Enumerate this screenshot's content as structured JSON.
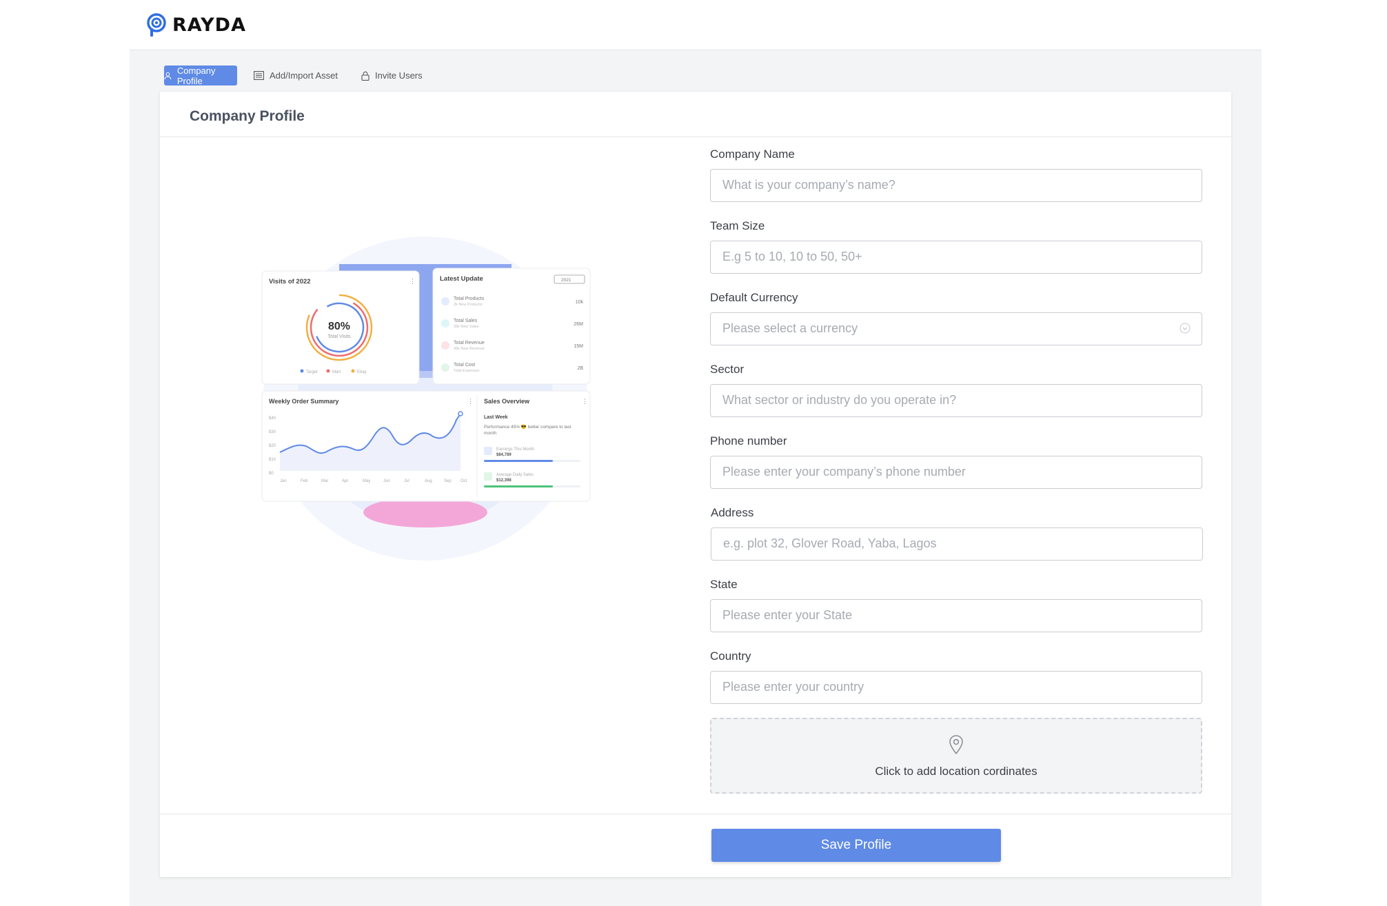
{
  "brand": {
    "name": "RAYDA"
  },
  "tabs": [
    {
      "label": "Company Profile",
      "icon": "user-icon",
      "active": true
    },
    {
      "label": "Add/Import Asset",
      "icon": "list-icon",
      "active": false
    },
    {
      "label": "Invite Users",
      "icon": "lock-icon",
      "active": false
    }
  ],
  "page": {
    "title": "Company Profile"
  },
  "form": {
    "company_name": {
      "label": "Company Name",
      "placeholder": "What is your company’s name?"
    },
    "team_size": {
      "label": "Team Size",
      "placeholder": "E.g 5 to 10, 10 to 50, 50+"
    },
    "currency": {
      "label": "Default Currency",
      "placeholder": "Please select a currency"
    },
    "sector": {
      "label": "Sector",
      "placeholder": "What sector or industry do you operate in?"
    },
    "phone": {
      "label": "Phone number",
      "placeholder": "Please enter your company’s phone number"
    },
    "address": {
      "label": "Address",
      "placeholder": "e.g. plot 32, Glover Road, Yaba, Lagos"
    },
    "state": {
      "label": "State",
      "placeholder": "Please enter your State"
    },
    "country": {
      "label": "Country",
      "placeholder": "Please enter your country"
    },
    "location": {
      "label": "Click to add location cordinates",
      "icon": "map-pin-icon"
    }
  },
  "actions": {
    "save_label": "Save Profile"
  },
  "illustration": {
    "visits": {
      "title": "Visits of 2022",
      "percent": "80%",
      "sub": "Total Visits",
      "legend": [
        "Target",
        "Mart",
        "Ebay"
      ]
    },
    "latest": {
      "title": "Latest Update",
      "year": "2021",
      "rows": [
        {
          "name": "Total Products",
          "sub": "2k New Products",
          "value": "10k"
        },
        {
          "name": "Total Sales",
          "sub": "39k New Sales",
          "value": "26M"
        },
        {
          "name": "Total Revenue",
          "sub": "43k New Revenue",
          "value": "15M"
        },
        {
          "name": "Total Cost",
          "sub": "Total Expenses",
          "value": "2B"
        }
      ]
    },
    "weekly": {
      "title": "Weekly Order Summary",
      "yticks": [
        "$40",
        "$30",
        "$20",
        "$10",
        "$0"
      ],
      "xticks": [
        "Jan",
        "Feb",
        "Mar",
        "Apr",
        "May",
        "Jun",
        "Jul",
        "Aug",
        "Sep",
        "Oct"
      ]
    },
    "sales": {
      "title": "Sales Overview",
      "period": "Last Week",
      "note": "Performance 45% 😎 better compare to last month",
      "earn_label": "Earnings This Month",
      "earn_value": "$84,789",
      "daily_label": "Average Daily Sales",
      "daily_value": "$12,398"
    }
  },
  "colors": {
    "accent": "#5f8ae6",
    "background": "#f3f4f5"
  }
}
